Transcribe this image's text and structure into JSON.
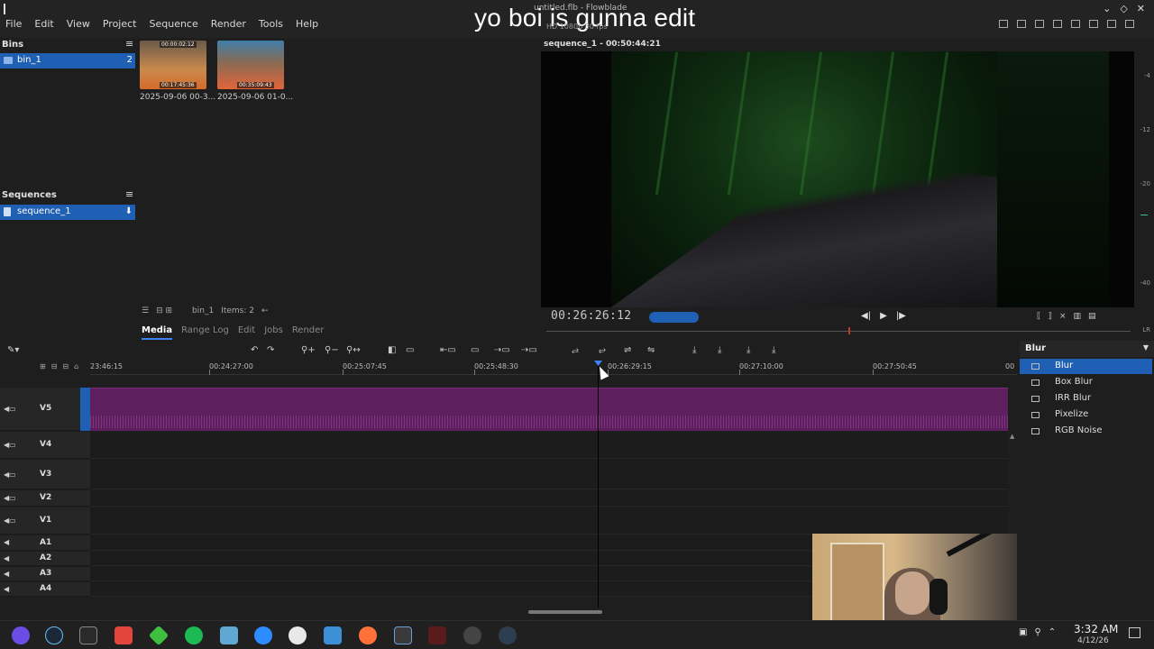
{
  "window": {
    "title": "untitled.flb - Flowblade",
    "caption": "yo boi is gunna edit",
    "controls": [
      "⌄",
      "◇",
      "✕"
    ]
  },
  "menu": [
    "File",
    "Edit",
    "View",
    "Project",
    "Sequence",
    "Render",
    "Tools",
    "Help"
  ],
  "bins": {
    "header": "Bins",
    "items": [
      {
        "label": "bin_1",
        "count": "2"
      }
    ]
  },
  "sequences": {
    "header": "Sequences",
    "items": [
      {
        "label": "sequence_1"
      }
    ]
  },
  "media": {
    "clips": [
      {
        "label": "2025-09-06 00-3...",
        "tc_start": "00:00:02:12",
        "tc_end": "00:17:45:36"
      },
      {
        "label": "2025-09-06 01-0...",
        "tc_end": "00:35:09:43"
      }
    ],
    "bin_name": "bin_1",
    "items_count": "Items: 2",
    "tabs": [
      "Media",
      "Range Log",
      "Edit",
      "Jobs",
      "Render"
    ],
    "active_tab": "Media"
  },
  "monitor": {
    "title": "sequence_1 - 00:50:44:21",
    "format_label": "HD 1080p 30 fps",
    "timecode": "00:26:26:12",
    "meter_scale": [
      "-4",
      "-12",
      "-20",
      "-40",
      "LR"
    ]
  },
  "timeline": {
    "ruler_ticks": [
      "23:46:15",
      "00:24:27:00",
      "00:25:07:45",
      "00:25:48:30",
      "00:26:29:15",
      "00:27:10:00",
      "00:27:50:45",
      "00"
    ],
    "tracks": [
      "V5",
      "V4",
      "V3",
      "V2",
      "V1",
      "A1",
      "A2",
      "A3",
      "A4"
    ]
  },
  "filters": {
    "group": "Blur",
    "items": [
      "Blur",
      "Box Blur",
      "IRR Blur",
      "Pixelize",
      "RGB Noise"
    ],
    "selected": "Blur"
  },
  "taskbar": {
    "time": "3:32 AM",
    "date": "4/12/26"
  }
}
